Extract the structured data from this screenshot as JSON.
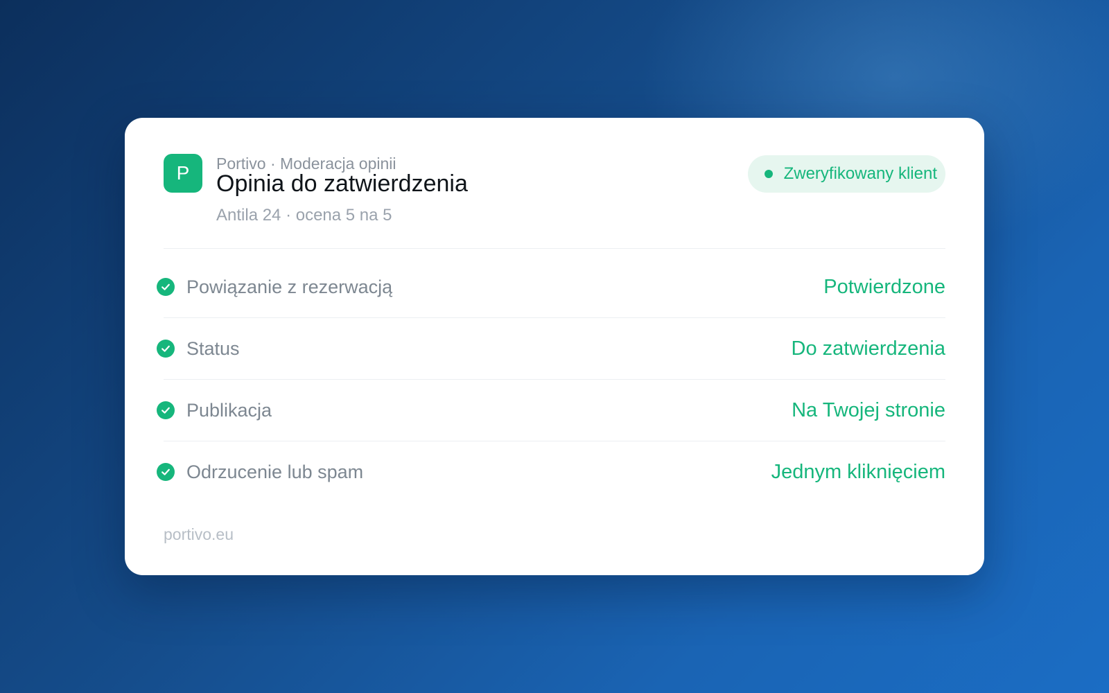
{
  "card": {
    "logo_letter": "P",
    "eyebrow": "Portivo · Moderacja opinii",
    "title": "Opinia do zatwierdzenia",
    "subtitle": "Antila 24 · ocena 5 na 5",
    "badge": {
      "label": "Zweryfikowany klient",
      "icon": "status-dot-icon"
    },
    "rows": [
      {
        "label": "Powiązanie z rezerwacją",
        "value": "Potwierdzone",
        "icon": "check-circle-icon"
      },
      {
        "label": "Status",
        "value": "Do zatwierdzenia",
        "icon": "check-circle-icon"
      },
      {
        "label": "Publikacja",
        "value": "Na Twojej stronie",
        "icon": "check-circle-icon"
      },
      {
        "label": "Odrzucenie lub spam",
        "value": "Jednym kliknięciem",
        "icon": "check-circle-icon"
      }
    ],
    "footer": "portivo.eu"
  },
  "colors": {
    "accent": "#16b67c",
    "badge_background": "#e6f6ef",
    "background_dark": "#0c2f5c",
    "background_light": "#1b6dc4"
  }
}
